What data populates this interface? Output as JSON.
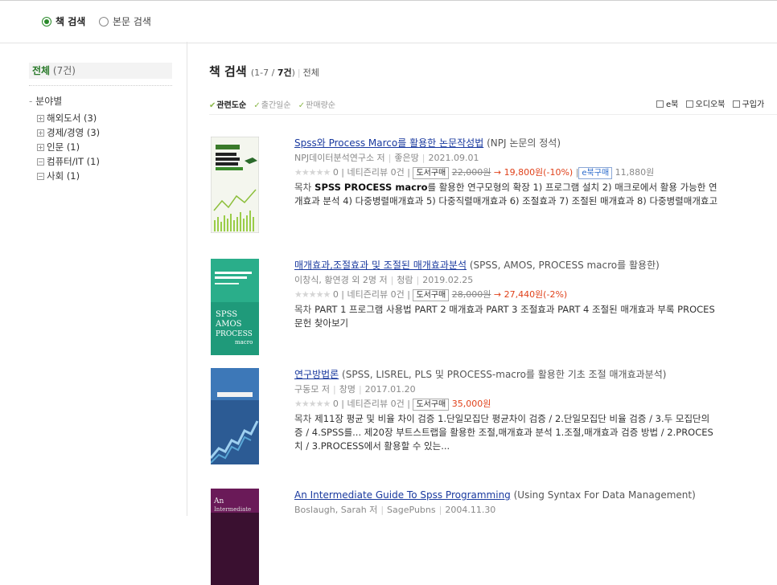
{
  "search_tabs": [
    {
      "label": "책 검색",
      "active": true
    },
    {
      "label": "본문 검색",
      "active": false
    }
  ],
  "sidebar": {
    "all_label": "전체",
    "all_count": "(7건)",
    "section_title": "분야별",
    "categories": [
      {
        "label": "해외도서 (3)",
        "expanded": false
      },
      {
        "label": "경제/경영 (3)",
        "expanded": false
      },
      {
        "label": "인문 (1)",
        "expanded": false
      },
      {
        "label": "컴퓨터/IT (1)",
        "expanded": true
      },
      {
        "label": "사회 (1)",
        "expanded": true
      }
    ]
  },
  "results": {
    "title": "책 검색",
    "count_prefix": "(1-7 / ",
    "count_bold": "7건",
    "count_suffix": ")",
    "scope": "전체",
    "sorts": [
      "관련도순",
      "출간일순",
      "판매량순"
    ],
    "filters": [
      "e북",
      "오디오북",
      "구입가"
    ],
    "toc_label": "목차",
    "buy_label": "도서구매",
    "ebook_label": "e북구매",
    "review_label": "네티즌리뷰 0건",
    "rating": "0"
  },
  "books": [
    {
      "title": "Spss와 Process Marco를 활용한 논문작성법",
      "subtitle": "(NPJ 논문의 정석)",
      "meta": [
        "NPJ데이터분석연구소 저",
        "좋은땅",
        "2021.09.01"
      ],
      "price_old": "22,000원",
      "price_new": "→ 19,800원(-10%)",
      "ebook_price": "11,880원",
      "toc": [
        "SPSS PROCESS macro를 활용한 연구모형의 확장 1) 프로그램 설치 2) 매크로에서 활용 가능한 연",
        "개효과 분석 4) 다중병렬매개효과 5) 다중직렬매개효과 6) 조절효과 7) 조절된 매개효과 8) 다중병렬매개효고"
      ]
    },
    {
      "title": "매개효과,조절효과 및 조절된 매개효과분석",
      "subtitle": "(SPSS, AMOS, PROCESS macro를 활용한)",
      "meta": [
        "이창식, 황연경 외 2명 저",
        "청람",
        "2019.02.25"
      ],
      "price_old": "28,000원",
      "price_new": "→ 27,440원(-2%)",
      "toc": [
        "PART 1 프로그램 사용법 PART 2 매개효과 PART 3 조절효과 PART 4 조절된 매개효과 부록 PROCES",
        "문헌 찾아보기"
      ]
    },
    {
      "title": "연구방법론",
      "subtitle": "(SPSS, LISREL, PLS 및 PROCESS-macro를 활용한 기초 조절 매개효과분석)",
      "meta": [
        "구동모 저",
        "창명",
        "2017.01.20"
      ],
      "price_new": "35,000원",
      "toc": [
        "제11장 평균 및 비율 차이 검증 1.단일모집단 평균차이 검증 / 2.단일모집단 비율 검증 / 3.두 모집단의",
        "증 / 4.SPSS를... 제20장 부트스트랩을 활용한 조절,매개효과 분석 1.조절,매개효과 검증 방법 / 2.PROCES",
        "치 / 3.PROCESS에서 활용할 수 있는..."
      ]
    },
    {
      "title": "An Intermediate Guide To Spss Programming",
      "subtitle": "(Using Syntax For Data Management)",
      "meta": [
        "Boslaugh, Sarah 저",
        "SagePubns",
        "2004.11.30"
      ]
    }
  ],
  "colors": {
    "accent_green": "#2a8a2a",
    "link_blue": "#1a3a9f",
    "price_red": "#e0421b"
  }
}
